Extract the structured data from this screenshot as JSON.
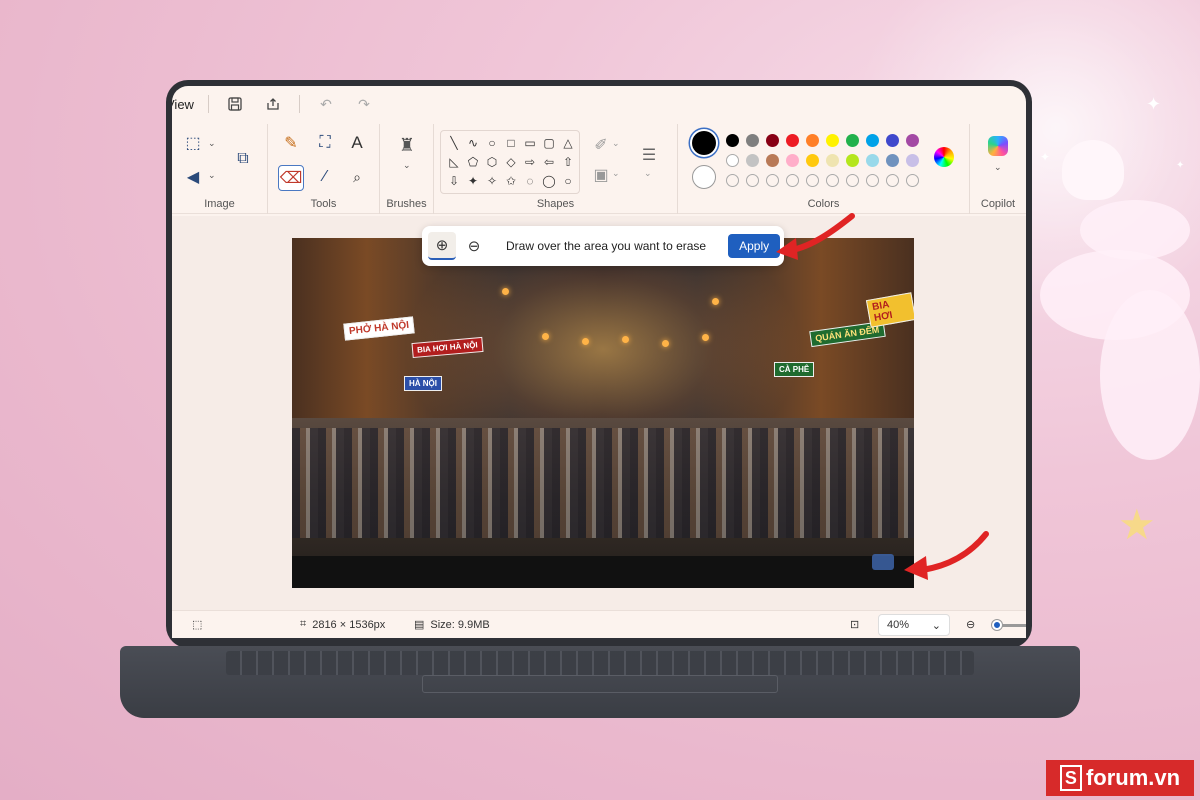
{
  "titlebar": {
    "menu_label": "View"
  },
  "ribbon": {
    "groups": {
      "image": "Image",
      "tools": "Tools",
      "brushes": "Brushes",
      "shapes": "Shapes",
      "colors": "Colors",
      "copilot": "Copilot"
    },
    "shapes_glyphs": [
      "╲",
      "∿",
      "○",
      "□",
      "▭",
      "▢",
      "△",
      "◺",
      "⬠",
      "⬡",
      "◇",
      "⇨",
      "⇦",
      "⇧",
      "⇩",
      "✦",
      "✧",
      "✩",
      "◌",
      "◯",
      "○"
    ],
    "palette_row1": [
      "#000000",
      "#7f7f7f",
      "#880015",
      "#ed1c24",
      "#ff7f27",
      "#fff200",
      "#22b14c",
      "#00a2e8",
      "#3f48cc",
      "#a349a4"
    ],
    "palette_row2": [
      "#ffffff",
      "#c3c3c3",
      "#b97a57",
      "#ffaec9",
      "#ffc90e",
      "#efe4b0",
      "#b5e61d",
      "#99d9ea",
      "#7092be",
      "#c8bfe7"
    ],
    "primary_color": "#000000",
    "secondary_color": "#ffffff"
  },
  "erase_popup": {
    "instruction": "Draw over the area you want to erase",
    "apply_label": "Apply"
  },
  "photo": {
    "signs": [
      "PHỞ HÀ NỘI",
      "QUÁN ĂN ĐÊM",
      "BIA HƠI",
      "CÀ PHÊ",
      "HÀ NỘI",
      "BIA HƠI HÀ NỘI"
    ]
  },
  "statusbar": {
    "dimensions": "2816 × 1536px",
    "size": "Size: 9.9MB",
    "zoom": "40%"
  },
  "brand": {
    "name": "forum.vn",
    "letter": "S"
  }
}
